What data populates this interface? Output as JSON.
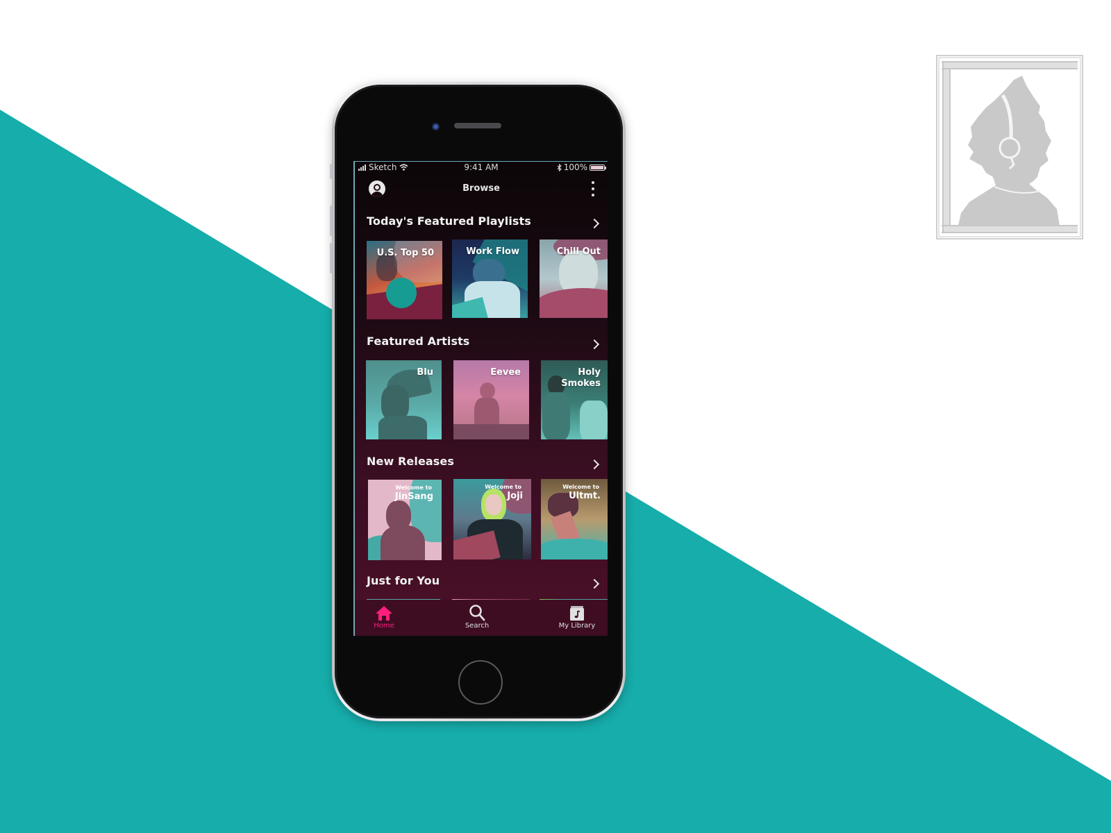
{
  "colors": {
    "background": "#ffffff",
    "accent_teal": "#16adab",
    "screen_bg_top": "#0c0608",
    "screen_bg_bottom": "#4c1028",
    "tab_bar_bg": "#3e0d22",
    "active_tab": "#ff1f7c",
    "logo_gray": "#c9c9c9"
  },
  "status_bar": {
    "carrier": "Sketch",
    "time": "9:41 AM",
    "battery": "100%",
    "icons": [
      "signal-icon",
      "wifi-icon",
      "bluetooth-icon",
      "battery-icon"
    ]
  },
  "nav": {
    "title": "Browse",
    "left_icon": "profile-icon",
    "right_icon": "more-vertical-icon"
  },
  "sections": [
    {
      "title": "Today's Featured Playlists",
      "items": [
        {
          "label": "U.S. Top 50"
        },
        {
          "label": "Work Flow"
        },
        {
          "label": "Chill Out"
        }
      ]
    },
    {
      "title": "Featured Artists",
      "items": [
        {
          "label": "Blu"
        },
        {
          "label": "Eevee"
        },
        {
          "label": "Holy Smokes"
        }
      ]
    },
    {
      "title": "New Releases",
      "items": [
        {
          "pre": "Welcome to",
          "label": "JinSang"
        },
        {
          "pre": "Welcome to",
          "label": "Joji"
        },
        {
          "pre": "Welcome to",
          "label": "Ultmt."
        }
      ]
    },
    {
      "title": "Just for You",
      "items": []
    }
  ],
  "tab_bar": {
    "tabs": [
      {
        "label": "Home",
        "icon": "home-icon",
        "active": true
      },
      {
        "label": "Search",
        "icon": "search-icon",
        "active": false
      },
      {
        "label": "My Library",
        "icon": "library-icon",
        "active": false
      }
    ]
  },
  "logo": {
    "icon": "headphone-bust-logo"
  }
}
